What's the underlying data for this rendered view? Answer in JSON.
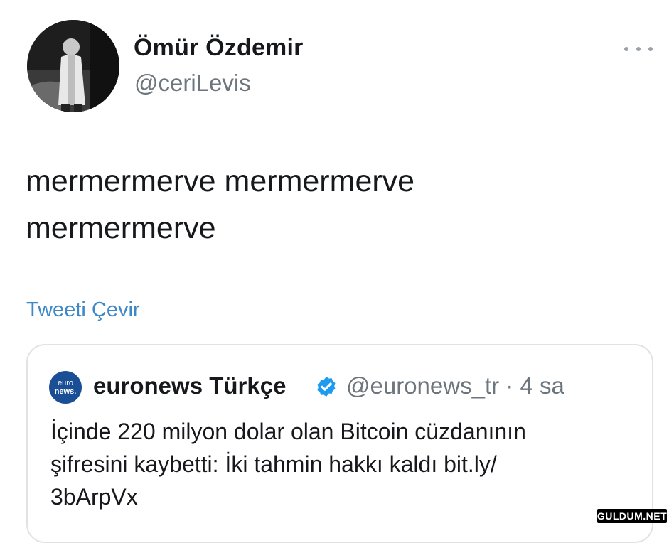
{
  "tweet": {
    "author": {
      "display_name": "Ömür Özdemir",
      "handle": "@ceriLevis"
    },
    "lines": [
      "mermermerve mermermerve",
      "mermermerve"
    ],
    "translate_label": "Tweeti Çevir"
  },
  "quoted_tweet": {
    "avatar": {
      "line1": "euro",
      "line2": "news."
    },
    "display_name": "euronews Türkçe",
    "handle": "@euronews_tr",
    "separator": "·",
    "time": "4 sa",
    "lines": [
      "İçinde 220 milyon dolar olan Bitcoin cüzdanının",
      "şifresini kaybetti: İki tahmin hakkı kaldı  bit.ly/",
      "3bArpVx"
    ]
  },
  "watermark": "GULDUM.NET",
  "colors": {
    "link": "#3f88c5",
    "verified": "#1d9bf0",
    "secondary_text": "#6e767d",
    "card_border": "#dfe3e6"
  },
  "icons": {
    "more": "more-icon",
    "verified": "verified-badge-icon"
  }
}
